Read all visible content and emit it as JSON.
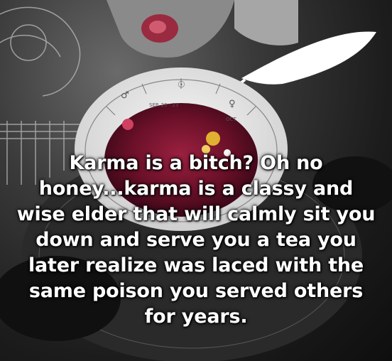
{
  "image": {
    "quote_lines": [
      "Karma is a bitch? Oh no",
      "honey...karma is a classy and",
      "wise elder that will calmly sit you",
      "down and serve you a tea you",
      "later realize was laced with the",
      "same poison you served others",
      "for years."
    ],
    "cup_date": "SEP. 20 - 23",
    "cup_side_text": "OCT",
    "colors": {
      "text": "#ffffff",
      "tea": "#7a1530",
      "rose": "#c0405a",
      "background": "#1a1a1a"
    }
  }
}
